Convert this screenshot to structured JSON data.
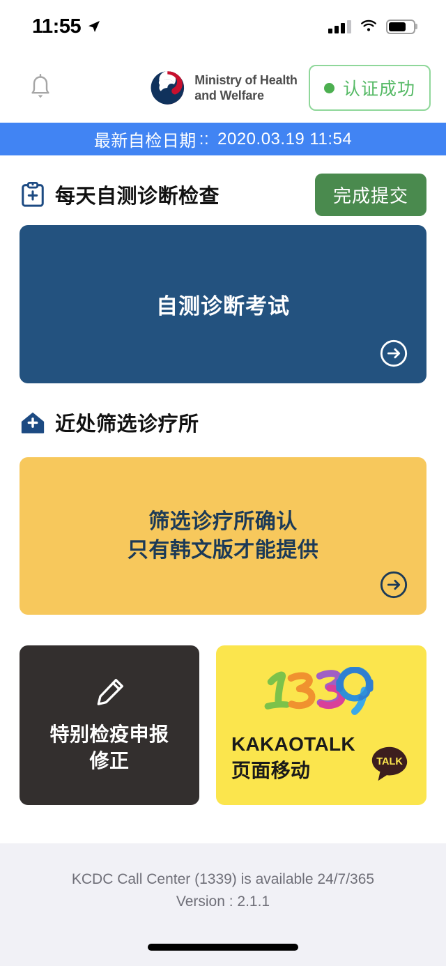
{
  "status_bar": {
    "time": "11:55",
    "location_icon": "location-arrow-icon",
    "signal_icon": "cellular-signal-icon",
    "wifi_icon": "wifi-icon",
    "battery_icon": "battery-icon"
  },
  "header": {
    "bell_icon": "notification-bell-icon",
    "logo_icon": "korea-government-taegeuk-logo",
    "brand_name": "Ministry of Health\nand Welfare",
    "auth_badge": {
      "label": "认证成功",
      "dot_color": "#4caf50",
      "border_color": "#8fd79a",
      "text_color": "#54b964"
    }
  },
  "date_banner": {
    "label": "最新自检日期",
    "separator": "::",
    "value": "2020.03.19 11:54",
    "background_color": "#4184f3"
  },
  "self_check_section": {
    "icon": "clipboard-plus-icon",
    "title": "每天自测诊断检查",
    "submit_label": "完成提交",
    "submit_color": "#4a8a4e",
    "card": {
      "text": "自测诊断考试",
      "background_color": "#23527f",
      "arrow_icon": "arrow-right-circle-icon"
    }
  },
  "clinic_section": {
    "icon": "hospital-home-icon",
    "title": "近处筛选诊疗所",
    "card": {
      "text": "筛选诊疗所确认\n只有韩文版才能提供",
      "background_color": "#f7c85c",
      "arrow_icon": "arrow-right-circle-icon"
    }
  },
  "tiles": {
    "quarantine": {
      "icon": "pencil-edit-icon",
      "text": "特别检疫申报\n修正",
      "background_color": "#332f2e"
    },
    "kakao": {
      "logo": "1339-call-center-logo",
      "text": "KAKAOTALK\n页面移动",
      "badge_label": "TALK",
      "background_color": "#fbe54d"
    }
  },
  "footer": {
    "line1": "KCDC Call Center (1339) is available 24/7/365",
    "line2": "Version : 2.1.1"
  }
}
